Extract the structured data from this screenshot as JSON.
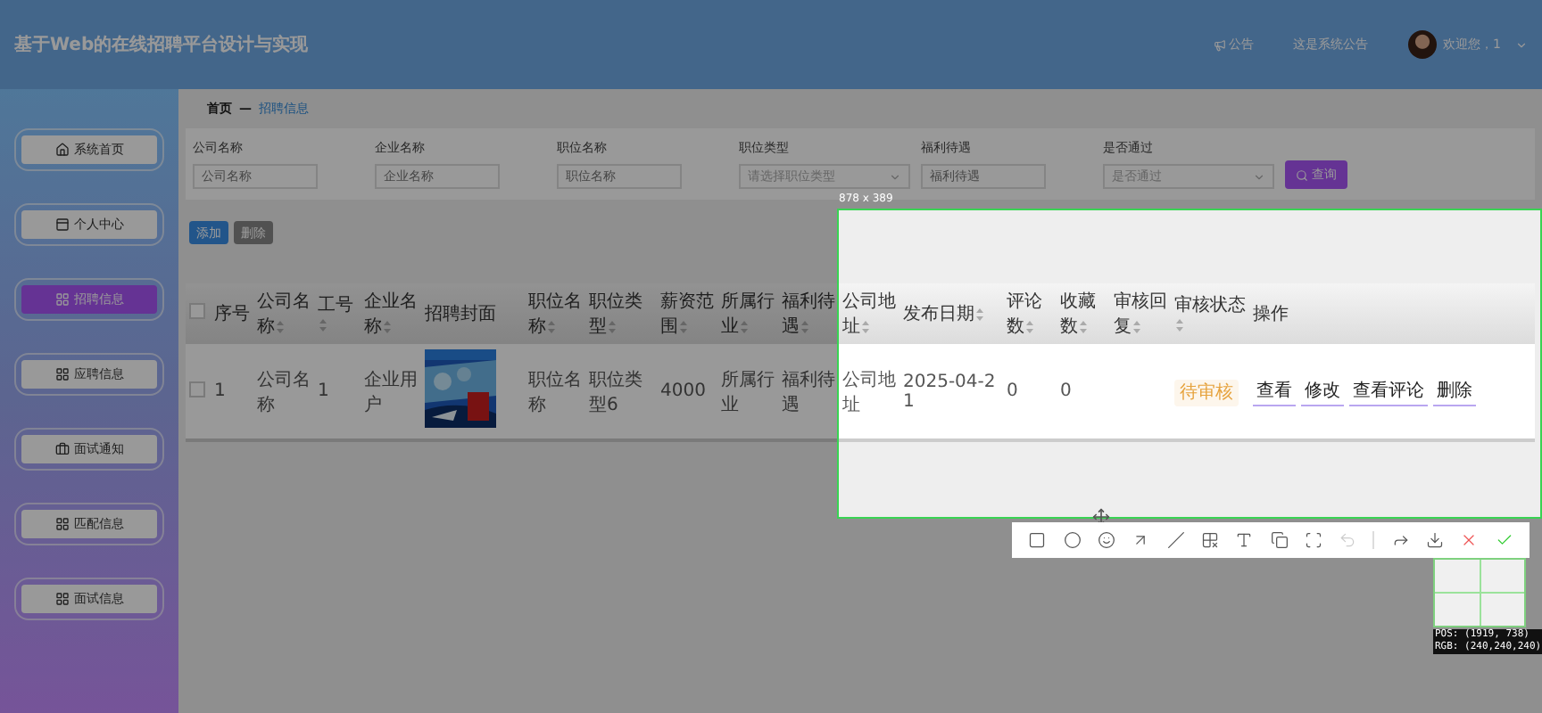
{
  "header": {
    "title": "基于Web的在线招聘平台设计与实现",
    "notice_label": "公告",
    "notice_text": "这是系统公告",
    "user": "欢迎您，1"
  },
  "sidebar": {
    "items": [
      {
        "label": "系统首页",
        "kind": "home",
        "selected": false
      },
      {
        "label": "个人中心",
        "kind": "panel",
        "selected": false
      },
      {
        "label": "招聘信息",
        "kind": "grid",
        "selected": true
      },
      {
        "label": "应聘信息",
        "kind": "grid",
        "selected": false
      },
      {
        "label": "面试通知",
        "kind": "briefcase",
        "selected": false
      },
      {
        "label": "匹配信息",
        "kind": "grid",
        "selected": false
      },
      {
        "label": "面试信息",
        "kind": "grid",
        "selected": false
      }
    ]
  },
  "breadcrumb": {
    "home": "首页",
    "separator": "—",
    "current": "招聘信息"
  },
  "filters": [
    {
      "label": "公司名称",
      "placeholder": "公司名称",
      "kind": "input"
    },
    {
      "label": "企业名称",
      "placeholder": "企业名称",
      "kind": "input"
    },
    {
      "label": "职位名称",
      "placeholder": "职位名称",
      "kind": "input"
    },
    {
      "label": "职位类型",
      "placeholder": "请选择职位类型",
      "kind": "select"
    },
    {
      "label": "福利待遇",
      "placeholder": "福利待遇",
      "kind": "input"
    },
    {
      "label": "是否通过",
      "placeholder": "是否通过",
      "kind": "select"
    }
  ],
  "search_button": "查询",
  "actions": [
    {
      "label": "添加",
      "kind": "primary"
    },
    {
      "label": "删除",
      "kind": "secondary"
    }
  ],
  "table": {
    "header_checked": false,
    "columns": [
      {
        "label": "序号",
        "sortable": false
      },
      {
        "label": "公司名称",
        "sortable": true
      },
      {
        "label": "工号",
        "sortable": true
      },
      {
        "label": "企业名称",
        "sortable": true
      },
      {
        "label": "招聘封面",
        "sortable": false
      },
      {
        "label": "职位名称",
        "sortable": true
      },
      {
        "label": "职位类型",
        "sortable": true
      },
      {
        "label": "薪资范围",
        "sortable": true
      },
      {
        "label": "所属行业",
        "sortable": true
      },
      {
        "label": "福利待遇",
        "sortable": true
      },
      {
        "label": "公司地址",
        "sortable": true
      },
      {
        "label": "发布日期",
        "sortable": true
      },
      {
        "label": "评论数",
        "sortable": true
      },
      {
        "label": "收藏数",
        "sortable": true
      },
      {
        "label": "审核回复",
        "sortable": true
      },
      {
        "label": "审核状态",
        "sortable": true
      },
      {
        "label": "操作",
        "sortable": false
      }
    ],
    "rows": [
      {
        "checked": false,
        "cells": [
          {
            "kind": "text",
            "text": "1"
          },
          {
            "kind": "text",
            "text": "公司名称"
          },
          {
            "kind": "text",
            "text": "1"
          },
          {
            "kind": "text",
            "text": "企业用户"
          },
          {
            "kind": "picture"
          },
          {
            "kind": "text",
            "text": "职位名称"
          },
          {
            "kind": "text",
            "text": "职位类型6"
          },
          {
            "kind": "text",
            "text": "4000"
          },
          {
            "kind": "text",
            "text": "所属行业"
          },
          {
            "kind": "text",
            "text": "福利待遇"
          },
          {
            "kind": "text",
            "text": "公司地址"
          },
          {
            "kind": "text",
            "text": "2025-04-21"
          },
          {
            "kind": "text",
            "text": "0"
          },
          {
            "kind": "text",
            "text": "0"
          },
          {
            "kind": "blank"
          },
          {
            "kind": "badge",
            "text": "待审核"
          },
          {
            "kind": "actions",
            "buttons": [
              "查看",
              "修改",
              "查看评论",
              "删除"
            ]
          }
        ]
      }
    ]
  },
  "capture": {
    "size": "878 x 389",
    "tools": [
      {
        "kind": "square",
        "disabled": false
      },
      {
        "kind": "circle",
        "disabled": false
      },
      {
        "kind": "smile",
        "disabled": false
      },
      {
        "kind": "arrow",
        "disabled": false
      },
      {
        "kind": "line",
        "disabled": false
      },
      {
        "kind": "mosaic",
        "disabled": false
      },
      {
        "kind": "text",
        "disabled": false
      },
      {
        "kind": "copy",
        "disabled": false
      },
      {
        "kind": "scan",
        "disabled": false
      },
      {
        "kind": "undo",
        "disabled": true
      },
      {
        "kind": "separator"
      },
      {
        "kind": "share",
        "disabled": false
      },
      {
        "kind": "download",
        "disabled": false
      },
      {
        "kind": "close",
        "disabled": false
      },
      {
        "kind": "confirm",
        "disabled": false
      }
    ],
    "magnifier": {
      "pos": "POS: (1919, 738)",
      "rgb": "RGB: (240,240,240)"
    }
  }
}
